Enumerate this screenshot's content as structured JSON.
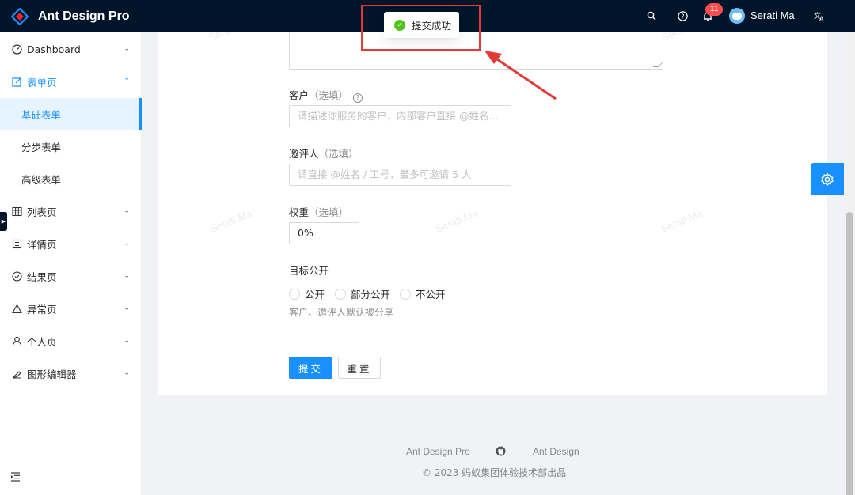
{
  "header": {
    "title": "Ant Design Pro",
    "notification_count": "11",
    "username": "Serati Ma",
    "icons": [
      "search-icon",
      "question-icon",
      "bell-icon",
      "translate-icon"
    ]
  },
  "toast": {
    "message": "提交成功",
    "icon": "check-circle-icon"
  },
  "sidebar": {
    "items": [
      {
        "label": "Dashboard",
        "icon": "dashboard-icon"
      },
      {
        "label": "表单页",
        "icon": "form-icon"
      },
      {
        "label": "基础表单"
      },
      {
        "label": "分步表单"
      },
      {
        "label": "高级表单"
      },
      {
        "label": "列表页",
        "icon": "table-icon"
      },
      {
        "label": "详情页",
        "icon": "profile-icon"
      },
      {
        "label": "结果页",
        "icon": "check-circle-icon"
      },
      {
        "label": "异常页",
        "icon": "warning-icon"
      },
      {
        "label": "个人页",
        "icon": "user-icon"
      },
      {
        "label": "图形编辑器",
        "icon": "highlight-icon"
      }
    ]
  },
  "form": {
    "client": {
      "label": "客户",
      "optional": "（选填）",
      "placeholder": "请描述你服务的客户，内部客户直接 @姓名..."
    },
    "invites": {
      "label": "邀评人",
      "optional": "（选填）",
      "placeholder": "请直接 @姓名 / 工号，最多可邀请 5 人"
    },
    "weight": {
      "label": "权重",
      "optional": "（选填）",
      "value": "0%"
    },
    "public": {
      "label": "目标公开",
      "options": [
        "公开",
        "部分公开",
        "不公开"
      ],
      "hint": "客户、邀评人默认被分享"
    },
    "submit_label": "提交",
    "reset_label": "重置"
  },
  "watermark": "Serati Ma",
  "footer": {
    "links": [
      "Ant Design Pro",
      "Ant Design"
    ],
    "copyright": "2023 蚂蚁集团体验技术部出品"
  },
  "colors": {
    "primary": "#1890ff",
    "header_bg": "#001529",
    "success": "#52c41a",
    "annotation": "#e53935"
  }
}
